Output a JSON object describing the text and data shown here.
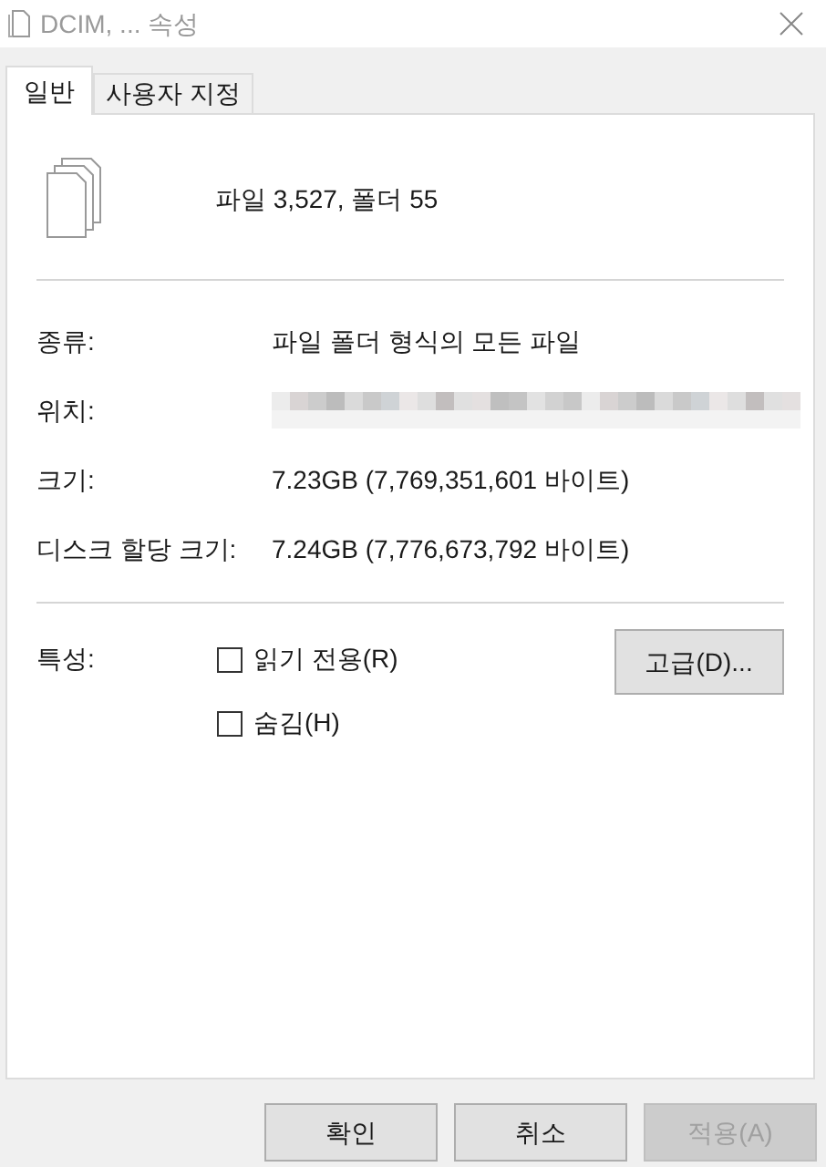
{
  "window": {
    "title": "DCIM, ... 속성",
    "active": false
  },
  "tabs": [
    {
      "label": "일반",
      "selected": true
    },
    {
      "label": "사용자 지정",
      "selected": false
    }
  ],
  "summary": "파일 3,527, 폴더 55",
  "details": [
    {
      "label": "종류:",
      "value": "파일 폴더 형식의 모든 파일"
    },
    {
      "label": "위치:",
      "redacted": true
    },
    {
      "label": "크기:",
      "value": "7.23GB (7,769,351,601 바이트)"
    },
    {
      "label": "디스크 할당 크기:",
      "value": "7.24GB (7,776,673,792 바이트)"
    }
  ],
  "attributes": {
    "label": "특성:",
    "options": [
      {
        "label": "읽기 전용(R)",
        "checked": false
      },
      {
        "label": "숨김(H)",
        "checked": false
      }
    ],
    "advanced_button": "고급(D)..."
  },
  "buttons": [
    {
      "label": "확인",
      "disabled": false
    },
    {
      "label": "취소",
      "disabled": false
    },
    {
      "label": "적용(A)",
      "disabled": true
    }
  ]
}
